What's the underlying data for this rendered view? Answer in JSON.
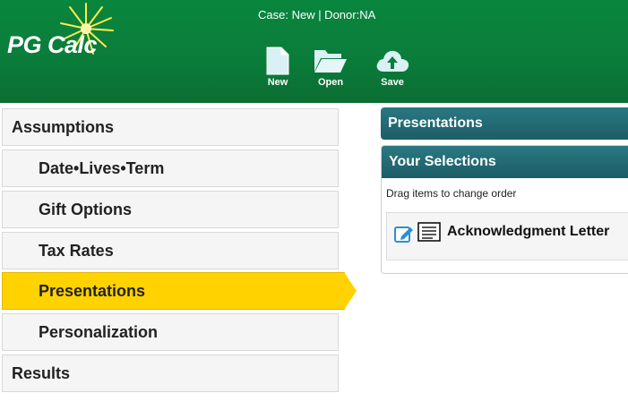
{
  "header": {
    "logo_text": "PG Calc",
    "case_info": "Case: New | Donor:NA",
    "toolbar": [
      {
        "label": "New",
        "icon": "new-document-icon"
      },
      {
        "label": "Open",
        "icon": "folder-open-icon"
      },
      {
        "label": "Save",
        "icon": "cloud-upload-icon"
      }
    ]
  },
  "nav": {
    "items": [
      {
        "label": "Assumptions",
        "level": 0,
        "active": false
      },
      {
        "label": "Date•Lives•Term",
        "level": 1,
        "active": false
      },
      {
        "label": "Gift Options",
        "level": 1,
        "active": false
      },
      {
        "label": "Tax Rates",
        "level": 1,
        "active": false
      },
      {
        "label": "Presentations",
        "level": 1,
        "active": true
      },
      {
        "label": "Personalization",
        "level": 1,
        "active": false
      },
      {
        "label": "Results",
        "level": 0,
        "active": false
      }
    ]
  },
  "main": {
    "panel_title": "Presentations",
    "selections": {
      "title": "Your Selections",
      "hint": "Drag items to change order",
      "items": [
        {
          "label": "Acknowledgment Letter"
        }
      ]
    }
  },
  "colors": {
    "header_green": "#0a7d3a",
    "active_yellow": "#ffd200",
    "panel_teal": "#1d5d66",
    "edit_icon_blue": "#2b8fd1"
  }
}
